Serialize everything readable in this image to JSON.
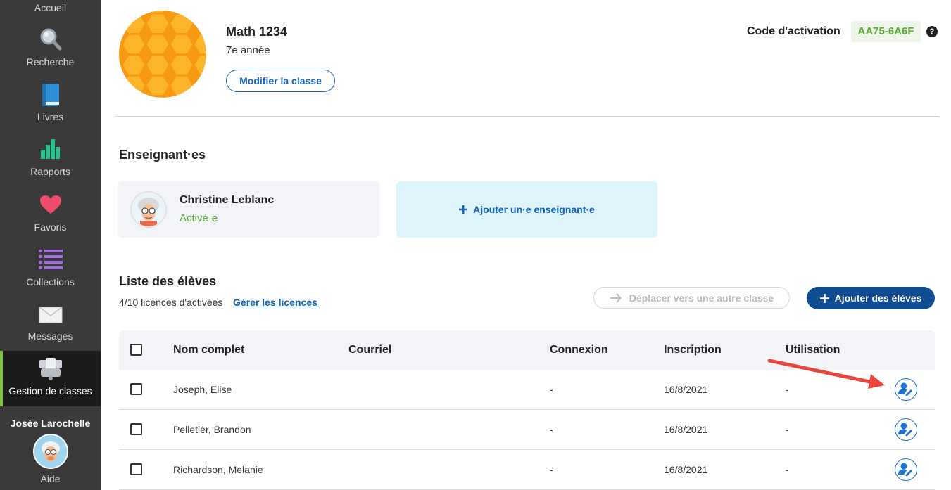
{
  "sidebar": {
    "items": [
      {
        "label": "Accueil",
        "icon": "home-icon"
      },
      {
        "label": "Recherche",
        "icon": "search-icon"
      },
      {
        "label": "Livres",
        "icon": "book-icon"
      },
      {
        "label": "Rapports",
        "icon": "bar-chart-icon"
      },
      {
        "label": "Favoris",
        "icon": "heart-icon"
      },
      {
        "label": "Collections",
        "icon": "list-icon"
      },
      {
        "label": "Messages",
        "icon": "envelope-icon"
      },
      {
        "label": "Gestion de classes",
        "icon": "class-management-icon"
      }
    ],
    "user_name": "Josée Larochelle",
    "help_label": "Aide"
  },
  "class": {
    "name": "Math 1234",
    "grade": "7e année",
    "edit_label": "Modifier la classe",
    "code_label": "Code d'activation",
    "code_value": "AA75-6A6F",
    "help_glyph": "?"
  },
  "teachers": {
    "title": "Enseignant·es",
    "items": [
      {
        "name": "Christine Leblanc",
        "status": "Activé·e"
      }
    ],
    "add_label": "Ajouter un·e enseignant·e"
  },
  "students": {
    "title": "Liste des élèves",
    "licenses_text": "4/10 licences d'activées",
    "manage_link": "Gérer les licences",
    "move_label": "Déplacer vers une autre classe",
    "add_label": "Ajouter des élèves",
    "columns": [
      "Nom complet",
      "Courriel",
      "Connexion",
      "Inscription",
      "Utilisation"
    ],
    "rows": [
      {
        "name": "Joseph, Elise",
        "email": "",
        "login": "-",
        "signup": "16/8/2021",
        "usage": "-"
      },
      {
        "name": "Pelletier, Brandon",
        "email": "",
        "login": "-",
        "signup": "16/8/2021",
        "usage": "-"
      },
      {
        "name": "Richardson, Melanie",
        "email": "",
        "login": "-",
        "signup": "16/8/2021",
        "usage": "-"
      }
    ]
  },
  "colors": {
    "accent_blue": "#1565c0",
    "primary_button": "#0f4c92",
    "success_green": "#5aa832",
    "sidebar_bg": "#3a3a3a",
    "arrow_red": "#e8453c"
  }
}
